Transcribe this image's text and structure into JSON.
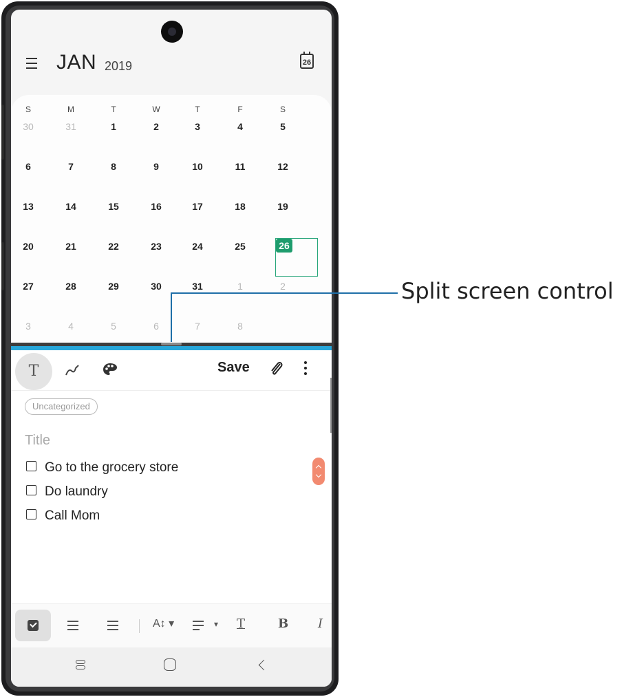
{
  "calendar": {
    "month": "JAN",
    "year": "2019",
    "today_icon_label": "26",
    "weekdays": [
      "S",
      "M",
      "T",
      "W",
      "T",
      "F",
      "S"
    ],
    "weeks": [
      [
        {
          "d": "30",
          "m": true
        },
        {
          "d": "31",
          "m": true
        },
        {
          "d": "1"
        },
        {
          "d": "2"
        },
        {
          "d": "3"
        },
        {
          "d": "4"
        },
        {
          "d": "5"
        }
      ],
      [
        {
          "d": "6"
        },
        {
          "d": "7"
        },
        {
          "d": "8"
        },
        {
          "d": "9"
        },
        {
          "d": "10"
        },
        {
          "d": "11"
        },
        {
          "d": "12"
        }
      ],
      [
        {
          "d": "13"
        },
        {
          "d": "14"
        },
        {
          "d": "15"
        },
        {
          "d": "16"
        },
        {
          "d": "17"
        },
        {
          "d": "18"
        },
        {
          "d": "19"
        }
      ],
      [
        {
          "d": "20"
        },
        {
          "d": "21"
        },
        {
          "d": "22"
        },
        {
          "d": "23"
        },
        {
          "d": "24"
        },
        {
          "d": "25"
        },
        {
          "d": "26",
          "today": true
        }
      ],
      [
        {
          "d": "27"
        },
        {
          "d": "28"
        },
        {
          "d": "29"
        },
        {
          "d": "30"
        },
        {
          "d": "31"
        },
        {
          "d": "1",
          "m": true
        },
        {
          "d": "2",
          "m": true
        }
      ],
      [
        {
          "d": "3",
          "m": true
        },
        {
          "d": "4",
          "m": true
        },
        {
          "d": "5",
          "m": true
        },
        {
          "d": "6",
          "m": true
        },
        {
          "d": "7",
          "m": true
        },
        {
          "d": "8",
          "m": true
        }
      ]
    ],
    "today": "26",
    "fab_label": "+",
    "accent_color": "#21a47a"
  },
  "notes": {
    "save_label": "Save",
    "category": "Uncategorized",
    "title_placeholder": "Title",
    "todos": [
      "Go to the grocery store",
      "Do laundry",
      "Call Mom"
    ],
    "format_bar": {
      "text_size_label": "A",
      "underline_label": "T",
      "bold_label": "B",
      "italic_label": "I"
    }
  },
  "split_divider_color": "#27a6d9",
  "callout": {
    "label": "Split screen control"
  }
}
